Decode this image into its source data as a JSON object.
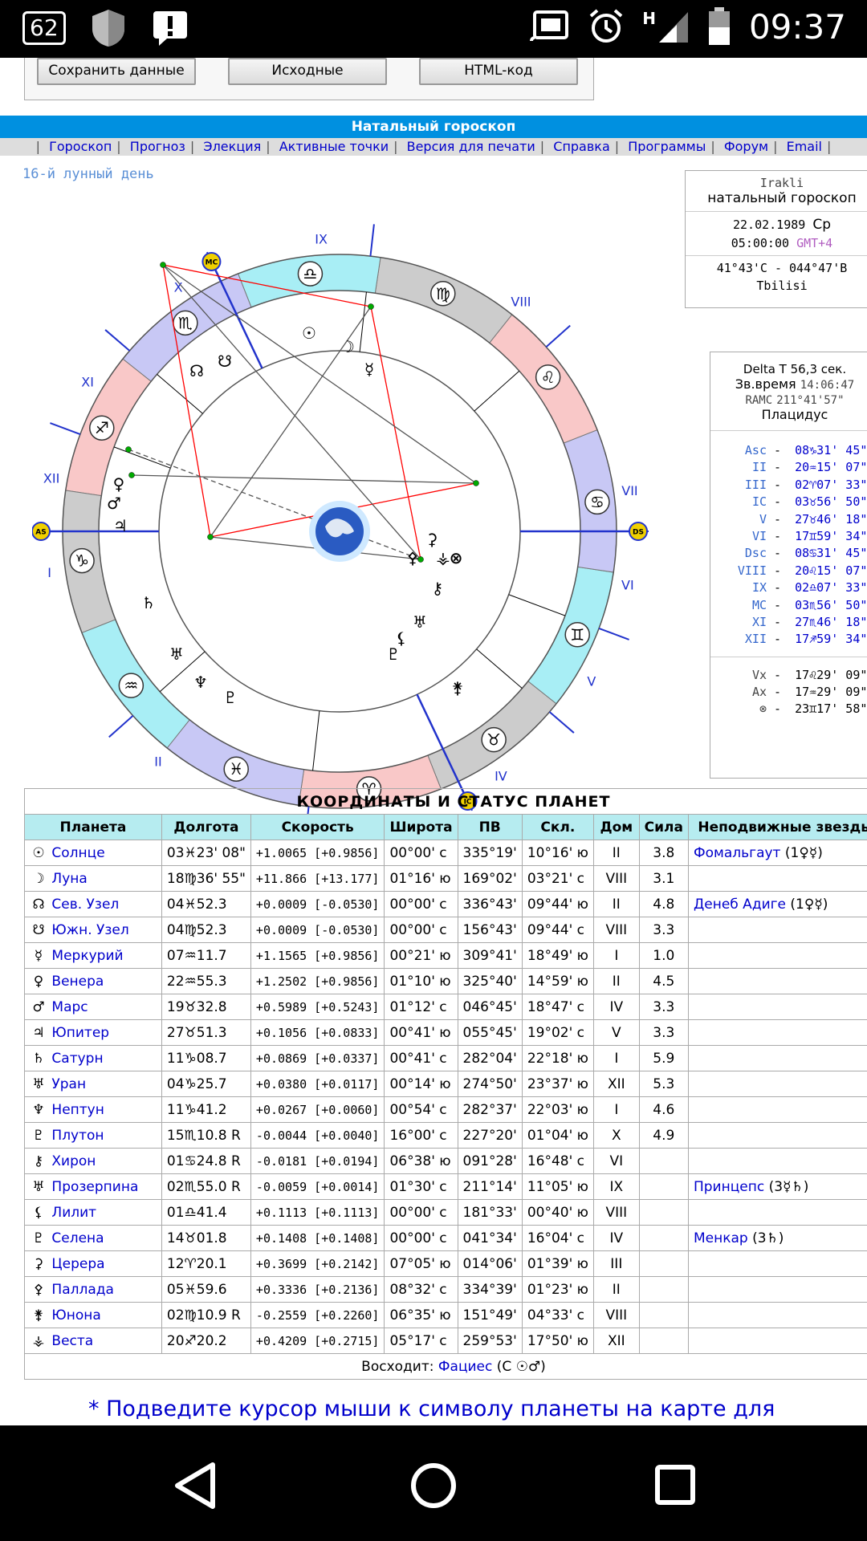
{
  "status_bar": {
    "notification_count": "62",
    "time": "09:37",
    "network_type": "H"
  },
  "top_buttons": [
    "Сохранить данные",
    "Исходные",
    "HTML-код"
  ],
  "title": "Натальный гороскоп",
  "menu": [
    "Гороскоп",
    "Прогноз",
    "Элекция",
    "Активные точки",
    "Версия для печати",
    "Справка",
    "Программы",
    "Форум",
    "Email"
  ],
  "lunar_day": "16-й лунный день",
  "chart": {
    "house_numerals": [
      "I",
      "II",
      "III",
      "IV",
      "V",
      "VI",
      "VII",
      "VIII",
      "IX",
      "X",
      "XI",
      "XII"
    ],
    "axis_labels": [
      "AS",
      "DS",
      "MC",
      "IC"
    ],
    "zodiac_signs": [
      "♈",
      "♉",
      "♊",
      "♋",
      "♌",
      "♍",
      "♎",
      "♏",
      "♐",
      "♑",
      "♒",
      "♓"
    ],
    "planet_glyphs": [
      "☉",
      "☽",
      "☊",
      "☋",
      "☿",
      "♀",
      "♂",
      "♃",
      "♄",
      "♅",
      "♆",
      "♇",
      "⚷",
      "♅",
      "⚸",
      "♇",
      "⚳",
      "⚴",
      "⚵",
      "⚶",
      "⊗"
    ]
  },
  "info": {
    "name": "Irakli",
    "subtitle": "натальный гороскоп",
    "date": "22.02.1989",
    "weekday": "Ср",
    "time": "05:00:00",
    "gmt": "GMT+4",
    "coords": "41°43'С - 044°47'В",
    "city": "Tbilisi"
  },
  "houses_box": {
    "delta_t_label": "Delta T",
    "delta_t": "56,3 сек.",
    "star_time_label": "Зв.время",
    "star_time": "14:06:47",
    "ramc_label": "RAMC",
    "ramc": "211°41'57\"",
    "system": "Плацидус",
    "cusps": [
      {
        "name": "Asc",
        "value": "08♑31' 45\""
      },
      {
        "name": "II",
        "value": "20♒15' 07\""
      },
      {
        "name": "III",
        "value": "02♈07' 33\""
      },
      {
        "name": "IC",
        "value": "03♉56' 50\""
      },
      {
        "name": "V",
        "value": "27♉46' 18\""
      },
      {
        "name": "VI",
        "value": "17♊59' 34\""
      },
      {
        "name": "Dsc",
        "value": "08♋31' 45\""
      },
      {
        "name": "VIII",
        "value": "20♌15' 07\""
      },
      {
        "name": "IX",
        "value": "02♎07' 33\""
      },
      {
        "name": "MC",
        "value": "03♏56' 50\""
      },
      {
        "name": "XI",
        "value": "27♏46' 18\""
      },
      {
        "name": "XII",
        "value": "17♐59' 34\""
      }
    ],
    "points": [
      {
        "name": "Vx",
        "value": "17♌29' 09\""
      },
      {
        "name": "Ax",
        "value": "17♒29' 09\""
      },
      {
        "name": "⊗",
        "value": "23♊17' 58\""
      }
    ]
  },
  "table": {
    "caption": "КООРДИНАТЫ И СТАТУС ПЛАНЕТ",
    "headers": [
      "Планета",
      "Долгота",
      "Скорость",
      "Широта",
      "ПВ",
      "Скл.",
      "Дом",
      "Сила",
      "Неподвижные звезды"
    ],
    "rows": [
      {
        "g": "☉",
        "name": "Солнце",
        "lon": "03♓23' 08\"",
        "speed": "+1.0065 [+0.9856]",
        "lat": "00°00' с",
        "pv": "335°19'",
        "dec": "10°16' ю",
        "house": "II",
        "power": "3.8",
        "star": "Фомальгаут",
        "star_note": "(1♀☿)"
      },
      {
        "g": "☽",
        "name": "Луна",
        "lon": "18♍36' 55\"",
        "speed": "+11.866 [+13.177]",
        "lat": "01°16' ю",
        "pv": "169°02'",
        "dec": "03°21' с",
        "house": "VIII",
        "power": "3.1",
        "star": "",
        "star_note": ""
      },
      {
        "g": "☊",
        "name": "Сев. Узел",
        "lon": "04♓52.3",
        "speed": "+0.0009 [-0.0530]",
        "lat": "00°00' с",
        "pv": "336°43'",
        "dec": "09°44' ю",
        "house": "II",
        "power": "4.8",
        "star": "Денеб Адиге",
        "star_note": "(1♀☿)"
      },
      {
        "g": "☋",
        "name": "Южн. Узел",
        "lon": "04♍52.3",
        "speed": "+0.0009 [-0.0530]",
        "lat": "00°00' с",
        "pv": "156°43'",
        "dec": "09°44' с",
        "house": "VIII",
        "power": "3.3",
        "star": "",
        "star_note": ""
      },
      {
        "g": "☿",
        "name": "Меркурий",
        "lon": "07♒11.7",
        "speed": "+1.1565 [+0.9856]",
        "lat": "00°21' ю",
        "pv": "309°41'",
        "dec": "18°49' ю",
        "house": "I",
        "power": "1.0",
        "star": "",
        "star_note": ""
      },
      {
        "g": "♀",
        "name": "Венера",
        "lon": "22♒55.3",
        "speed": "+1.2502 [+0.9856]",
        "lat": "01°10' ю",
        "pv": "325°40'",
        "dec": "14°59' ю",
        "house": "II",
        "power": "4.5",
        "star": "",
        "star_note": ""
      },
      {
        "g": "♂",
        "name": "Марс",
        "lon": "19♉32.8",
        "speed": "+0.5989 [+0.5243]",
        "lat": "01°12' с",
        "pv": "046°45'",
        "dec": "18°47' с",
        "house": "IV",
        "power": "3.3",
        "star": "",
        "star_note": ""
      },
      {
        "g": "♃",
        "name": "Юпитер",
        "lon": "27♉51.3",
        "speed": "+0.1056 [+0.0833]",
        "lat": "00°41' ю",
        "pv": "055°45'",
        "dec": "19°02' с",
        "house": "V",
        "power": "3.3",
        "star": "",
        "star_note": ""
      },
      {
        "g": "♄",
        "name": "Сатурн",
        "lon": "11♑08.7",
        "speed": "+0.0869 [+0.0337]",
        "lat": "00°41' с",
        "pv": "282°04'",
        "dec": "22°18' ю",
        "house": "I",
        "power": "5.9",
        "star": "",
        "star_note": ""
      },
      {
        "g": "♅",
        "name": "Уран",
        "lon": "04♑25.7",
        "speed": "+0.0380 [+0.0117]",
        "lat": "00°14' ю",
        "pv": "274°50'",
        "dec": "23°37' ю",
        "house": "XII",
        "power": "5.3",
        "star": "",
        "star_note": ""
      },
      {
        "g": "♆",
        "name": "Нептун",
        "lon": "11♑41.2",
        "speed": "+0.0267 [+0.0060]",
        "lat": "00°54' с",
        "pv": "282°37'",
        "dec": "22°03' ю",
        "house": "I",
        "power": "4.6",
        "star": "",
        "star_note": ""
      },
      {
        "g": "♇",
        "name": "Плутон",
        "lon": "15♏10.8 R",
        "speed": "-0.0044 [+0.0040]",
        "lat": "16°00' с",
        "pv": "227°20'",
        "dec": "01°04' ю",
        "house": "X",
        "power": "4.9",
        "star": "",
        "star_note": ""
      },
      {
        "g": "⚷",
        "name": "Хирон",
        "lon": "01♋24.8 R",
        "speed": "-0.0181 [+0.0194]",
        "lat": "06°38' ю",
        "pv": "091°28'",
        "dec": "16°48' с",
        "house": "VI",
        "power": "",
        "star": "",
        "star_note": ""
      },
      {
        "g": "♅",
        "name": "Прозерпина",
        "lon": "02♏55.0 R",
        "speed": "-0.0059 [+0.0014]",
        "lat": "01°30' с",
        "pv": "211°14'",
        "dec": "11°05' ю",
        "house": "IX",
        "power": "",
        "star": "Принцепс",
        "star_note": "(3☿♄)"
      },
      {
        "g": "⚸",
        "name": "Лилит",
        "lon": "01♎41.4",
        "speed": "+0.1113 [+0.1113]",
        "lat": "00°00' с",
        "pv": "181°33'",
        "dec": "00°40' ю",
        "house": "VIII",
        "power": "",
        "star": "",
        "star_note": ""
      },
      {
        "g": "♇",
        "name": "Селена",
        "lon": "14♉01.8",
        "speed": "+0.1408 [+0.1408]",
        "lat": "00°00' с",
        "pv": "041°34'",
        "dec": "16°04' с",
        "house": "IV",
        "power": "",
        "star": "Менкар",
        "star_note": "(3♄)"
      },
      {
        "g": "⚳",
        "name": "Церера",
        "lon": "12♈20.1",
        "speed": "+0.3699 [+0.2142]",
        "lat": "07°05' ю",
        "pv": "014°06'",
        "dec": "01°39' ю",
        "house": "III",
        "power": "",
        "star": "",
        "star_note": ""
      },
      {
        "g": "⚴",
        "name": "Паллада",
        "lon": "05♓59.6",
        "speed": "+0.3336 [+0.2136]",
        "lat": "08°32' с",
        "pv": "334°39'",
        "dec": "01°23' ю",
        "house": "II",
        "power": "",
        "star": "",
        "star_note": ""
      },
      {
        "g": "⚵",
        "name": "Юнона",
        "lon": "02♍10.9 R",
        "speed": "-0.2559 [+0.2260]",
        "lat": "06°35' ю",
        "pv": "151°49'",
        "dec": "04°33' с",
        "house": "VIII",
        "power": "",
        "star": "",
        "star_note": ""
      },
      {
        "g": "⚶",
        "name": "Веста",
        "lon": "20♐20.2",
        "speed": "+0.4209 [+0.2715]",
        "lat": "05°17' с",
        "pv": "259°53'",
        "dec": "17°50' ю",
        "house": "XII",
        "power": "",
        "star": "",
        "star_note": ""
      }
    ],
    "ascendant_label": "Восходит:",
    "ascendant_link": "Фациес",
    "ascendant_note": "(С ☉♂)"
  },
  "footnote": "* Подведите курсор мыши к символу планеты на карте для",
  "colors": {
    "accent": "#0090e0",
    "header_cell": "#b6ecf0",
    "fire": "#f9c8c8",
    "earth": "#cccccc",
    "air": "#a8eef5",
    "water": "#c8c8f5",
    "link": "#0000cc"
  }
}
